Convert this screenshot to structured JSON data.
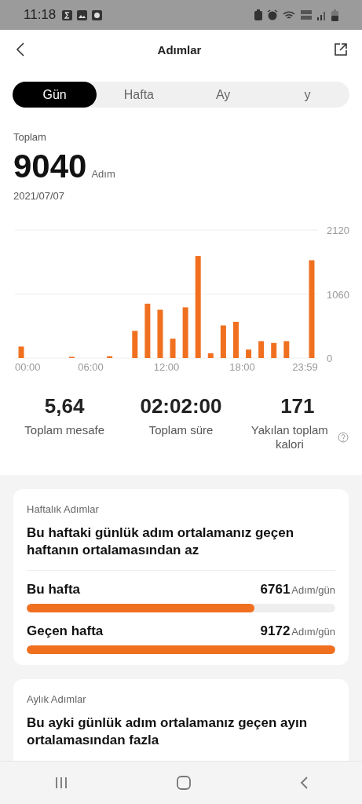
{
  "status_bar": {
    "time": "11:18"
  },
  "header": {
    "title": "Adımlar"
  },
  "tabs": [
    {
      "label": "Gün",
      "selected": true
    },
    {
      "label": "Hafta",
      "selected": false
    },
    {
      "label": "Ay",
      "selected": false
    },
    {
      "label": "y",
      "selected": false
    }
  ],
  "summary": {
    "label": "Toplam",
    "value": "9040",
    "unit": "Adım",
    "date": "2021/07/07"
  },
  "chart_data": {
    "type": "bar",
    "x": [
      30,
      270,
      450,
      570,
      630,
      690,
      750,
      810,
      870,
      930,
      990,
      1050,
      1110,
      1170,
      1230,
      1290,
      1410
    ],
    "series": [
      {
        "color": "#f07020",
        "values": [
          190,
          20,
          30,
          450,
          900,
          800,
          320,
          840,
          1690,
          80,
          540,
          600,
          140,
          280,
          250,
          280,
          1620
        ]
      }
    ],
    "xlim": [
      0,
      1440
    ],
    "ylim": [
      0,
      2120
    ],
    "yticks": [
      0,
      1060,
      2120
    ],
    "xticks": [
      {
        "value": 0,
        "label": "00:00"
      },
      {
        "value": 360,
        "label": "06:00"
      },
      {
        "value": 720,
        "label": "12:00"
      },
      {
        "value": 1080,
        "label": "18:00"
      },
      {
        "value": 1439,
        "label": "23:59"
      }
    ]
  },
  "stats": [
    {
      "value": "5,64",
      "label": "Toplam mesafe",
      "help": false
    },
    {
      "value": "02:02:00",
      "label": "Toplam süre",
      "help": false
    },
    {
      "value": "171",
      "label": "Yakılan toplam kalori",
      "help": true
    }
  ],
  "cards": [
    {
      "title": "Haftalık Adımlar",
      "message": "Bu haftaki günlük adım ortalamanız geçen haftanın ortalamasından az",
      "rows": [
        {
          "label": "Bu hafta",
          "value": "6761",
          "unit": "Adım/gün",
          "level": 0.737
        },
        {
          "label": "Geçen hafta",
          "value": "9172",
          "unit": "Adım/gün",
          "level": 1
        }
      ]
    },
    {
      "title": "Aylık Adımlar",
      "message": "Bu ayki günlük adım ortalamanız geçen ayın ortalamasından fazla"
    }
  ]
}
